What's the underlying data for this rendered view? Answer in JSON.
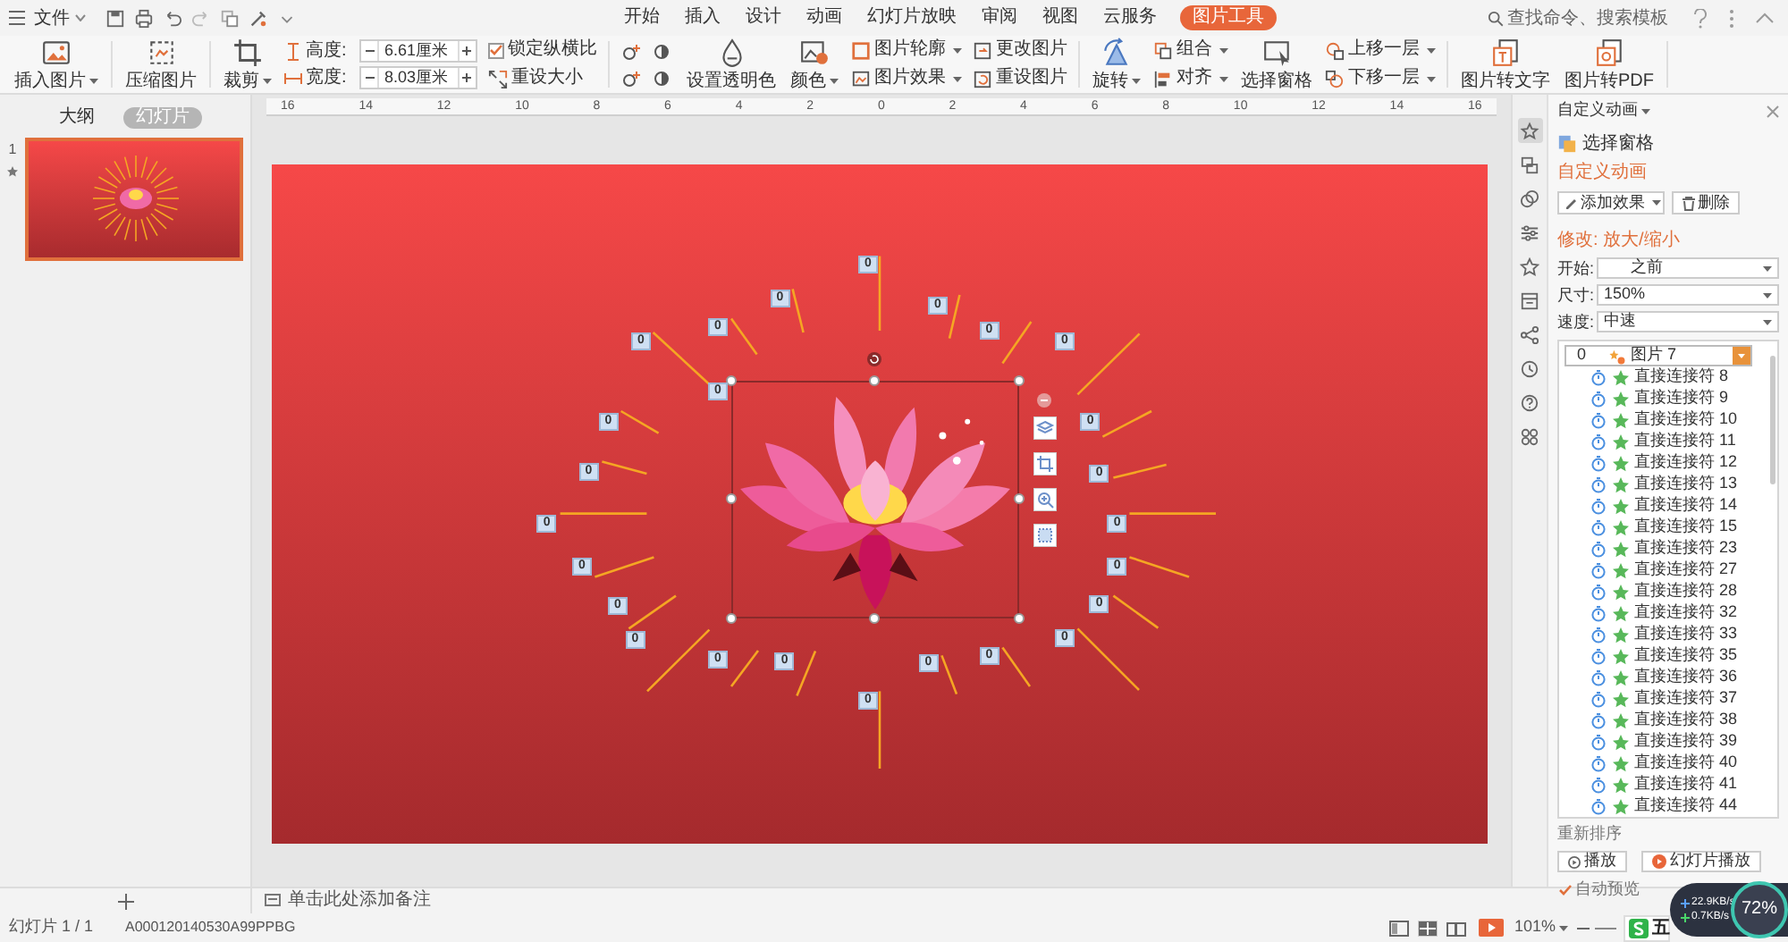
{
  "menu": {
    "label": "文件"
  },
  "tabs": [
    {
      "label": "开始",
      "selected": false
    },
    {
      "label": "插入",
      "selected": false
    },
    {
      "label": "设计",
      "selected": false
    },
    {
      "label": "动画",
      "selected": false
    },
    {
      "label": "幻灯片放映",
      "selected": false
    },
    {
      "label": "审阅",
      "selected": false
    },
    {
      "label": "视图",
      "selected": false
    },
    {
      "label": "云服务",
      "selected": false
    },
    {
      "label": "图片工具",
      "selected": true
    }
  ],
  "search": {
    "placeholder": "查找命令、搜索模板"
  },
  "ribbon": [
    {
      "kind": "large",
      "label": "插入图片",
      "dropdown": true
    },
    {
      "kind": "large",
      "label": "压缩图片",
      "dropdown": false
    },
    {
      "kind": "large",
      "label": "裁剪",
      "dropdown": true
    },
    {
      "kind": "size",
      "fields": [
        {
          "label": "高度:",
          "value": "6.61厘米"
        },
        {
          "label": "宽度:",
          "value": "8.03厘米"
        }
      ]
    },
    {
      "kind": "stack",
      "items": [
        {
          "kind": "checkbox",
          "label": "锁定纵横比",
          "checked": true
        },
        {
          "kind": "button",
          "label": "重设大小",
          "dropdown": false
        }
      ]
    },
    {
      "kind": "icons"
    },
    {
      "kind": "large",
      "label": "设置透明色",
      "dropdown": false
    },
    {
      "kind": "large",
      "label": "颜色",
      "dropdown": true
    },
    {
      "kind": "stack",
      "items": [
        {
          "kind": "button",
          "label": "图片轮廓",
          "dropdown": true
        },
        {
          "kind": "button",
          "label": "图片效果",
          "dropdown": true
        }
      ]
    },
    {
      "kind": "stack",
      "items": [
        {
          "kind": "button",
          "label": "更改图片",
          "dropdown": false
        },
        {
          "kind": "button",
          "label": "重设图片",
          "dropdown": false
        }
      ]
    },
    {
      "kind": "large",
      "label": "旋转",
      "dropdown": true
    },
    {
      "kind": "stack",
      "items": [
        {
          "kind": "button",
          "label": "组合",
          "dropdown": true
        },
        {
          "kind": "button",
          "label": "对齐",
          "dropdown": true
        }
      ]
    },
    {
      "kind": "large",
      "label": "选择窗格",
      "dropdown": false
    },
    {
      "kind": "stack",
      "items": [
        {
          "kind": "button",
          "label": "上移一层",
          "dropdown": true
        },
        {
          "kind": "button",
          "label": "下移一层",
          "dropdown": true
        }
      ]
    },
    {
      "kind": "large",
      "label": "图片转文字",
      "dropdown": false
    },
    {
      "kind": "large",
      "label": "图片转PDF",
      "dropdown": false
    }
  ],
  "ruler": {
    "labels": [
      "16",
      "14",
      "12",
      "10",
      "8",
      "6",
      "4",
      "2",
      "0",
      "2",
      "4",
      "6",
      "8",
      "10",
      "12",
      "14",
      "16"
    ]
  },
  "view_tabs": [
    {
      "label": "大纲",
      "selected": false
    },
    {
      "label": "幻灯片",
      "selected": true
    }
  ],
  "slides": [
    {
      "number": "1",
      "selected": true,
      "animated": true
    }
  ],
  "slide": {
    "order_tags": [
      "0",
      "0",
      "0",
      "0",
      "0",
      "0",
      "0",
      "0",
      "0",
      "0",
      "0",
      "0",
      "0",
      "0",
      "0",
      "0",
      "0",
      "0",
      "0",
      "0",
      "0",
      "0",
      "0",
      "0",
      "0"
    ]
  },
  "notes": {
    "placeholder": "单击此处添加备注"
  },
  "task_pane": {
    "title": "自定义动画",
    "tabs": [
      {
        "selected": true
      },
      {
        "selected": false
      },
      {
        "selected": false
      },
      {
        "selected": false
      },
      {
        "selected": false
      },
      {
        "selected": false
      },
      {
        "selected": false
      },
      {
        "selected": false
      },
      {
        "selected": false
      },
      {
        "selected": false
      }
    ],
    "select_pane": "选择窗格",
    "section": "自定义动画",
    "add_effect": "添加效果",
    "delete": "删除",
    "modify": "修改: 放大/缩小",
    "fields": [
      {
        "label": "开始:",
        "value": "之前"
      },
      {
        "label": "尺寸:",
        "value": "150%"
      },
      {
        "label": "速度:",
        "value": "中速"
      }
    ],
    "animations": [
      {
        "kind": "group",
        "order": "0",
        "name": "图片 7",
        "selected": true
      },
      {
        "kind": "item",
        "name": "直接连接符 8",
        "selected": false
      },
      {
        "kind": "item",
        "name": "直接连接符 9",
        "selected": false
      },
      {
        "kind": "item",
        "name": "直接连接符 10",
        "selected": false
      },
      {
        "kind": "item",
        "name": "直接连接符 11",
        "selected": false
      },
      {
        "kind": "item",
        "name": "直接连接符 12",
        "selected": false
      },
      {
        "kind": "item",
        "name": "直接连接符 13",
        "selected": false
      },
      {
        "kind": "item",
        "name": "直接连接符 14",
        "selected": false
      },
      {
        "kind": "item",
        "name": "直接连接符 15",
        "selected": false
      },
      {
        "kind": "item",
        "name": "直接连接符 23",
        "selected": false
      },
      {
        "kind": "item",
        "name": "直接连接符 27",
        "selected": false
      },
      {
        "kind": "item",
        "name": "直接连接符 28",
        "selected": false
      },
      {
        "kind": "item",
        "name": "直接连接符 32",
        "selected": false
      },
      {
        "kind": "item",
        "name": "直接连接符 33",
        "selected": false
      },
      {
        "kind": "item",
        "name": "直接连接符 35",
        "selected": false
      },
      {
        "kind": "item",
        "name": "直接连接符 36",
        "selected": false
      },
      {
        "kind": "item",
        "name": "直接连接符 37",
        "selected": false
      },
      {
        "kind": "item",
        "name": "直接连接符 38",
        "selected": false
      },
      {
        "kind": "item",
        "name": "直接连接符 39",
        "selected": false
      },
      {
        "kind": "item",
        "name": "直接连接符 40",
        "selected": false
      },
      {
        "kind": "item",
        "name": "直接连接符 41",
        "selected": false
      },
      {
        "kind": "item",
        "name": "直接连接符 44",
        "selected": false
      }
    ],
    "reorder": "重新排序",
    "play": "播放",
    "slideshow": "幻灯片播放",
    "autopreview": {
      "label": "自动预览",
      "checked": true
    }
  },
  "status_bar": {
    "slide": "幻灯片 1 / 1",
    "template": "A000120140530A99PPBG",
    "zoom": "101%"
  },
  "network_monitor": {
    "upload": "22.9KB/s",
    "download": "0.7KB/s",
    "load": "72%"
  },
  "ime_bar": {
    "text": "五"
  }
}
